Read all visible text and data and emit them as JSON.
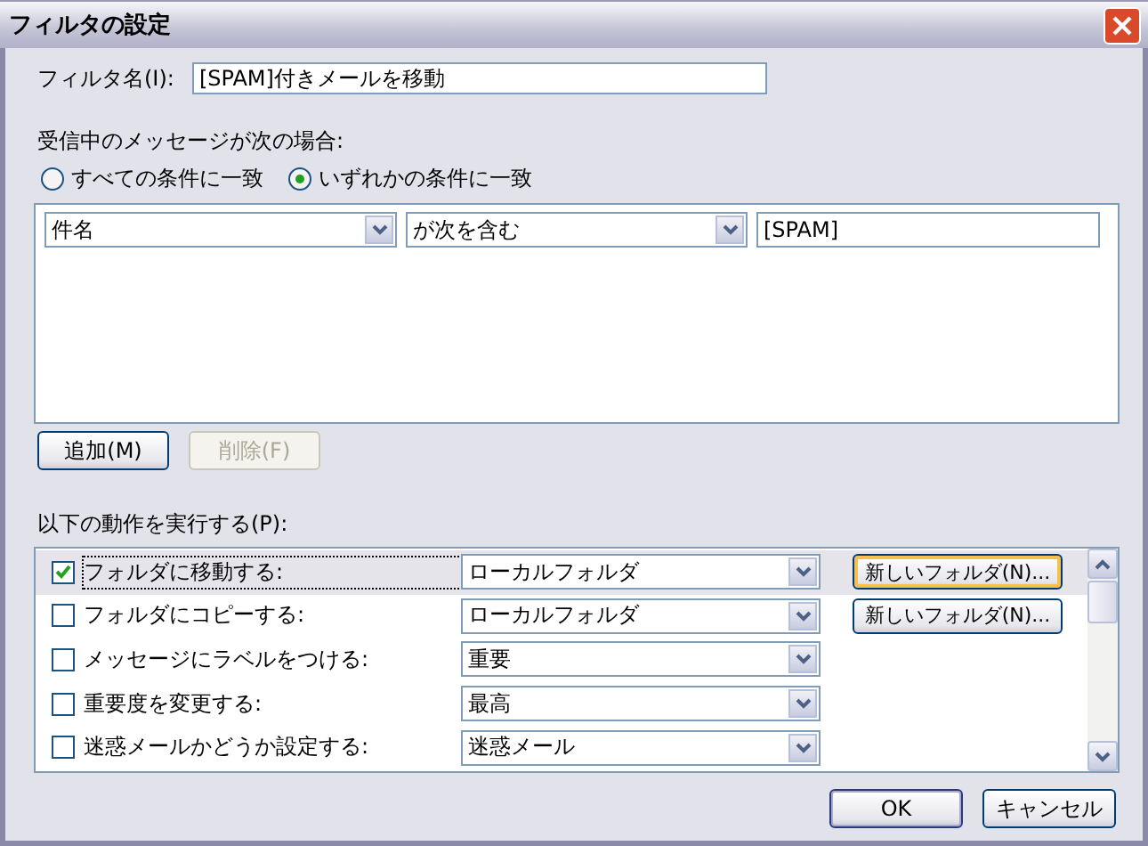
{
  "window": {
    "title": "フィルタの設定"
  },
  "filter_name": {
    "label": "フィルタ名(I):",
    "value": "[SPAM]付きメールを移動"
  },
  "match": {
    "label": "受信中のメッセージが次の場合:",
    "options": [
      {
        "label": "すべての条件に一致",
        "selected": false
      },
      {
        "label": "いずれかの条件に一致",
        "selected": true
      }
    ]
  },
  "conditions": [
    {
      "field": "件名",
      "operator": "が次を含む",
      "value": "[SPAM]"
    }
  ],
  "condition_buttons": [
    {
      "label": "追加(M)",
      "disabled": false
    },
    {
      "label": "削除(F)",
      "disabled": true
    }
  ],
  "actions_label": "以下の動作を実行する(P):",
  "actions": [
    {
      "label": "フォルダに移動する:",
      "checked": true,
      "selected": true,
      "value": "ローカルフォルダ",
      "button": "新しいフォルダ(N)..."
    },
    {
      "label": "フォルダにコピーする:",
      "checked": false,
      "selected": false,
      "value": "ローカルフォルダ",
      "button": "新しいフォルダ(N)..."
    },
    {
      "label": "メッセージにラベルをつける:",
      "checked": false,
      "selected": false,
      "value": "重要"
    },
    {
      "label": "重要度を変更する:",
      "checked": false,
      "selected": false,
      "value": "最高"
    },
    {
      "label": "迷惑メールかどうか設定する:",
      "checked": false,
      "selected": false,
      "value": "迷惑メール"
    }
  ],
  "buttons": [
    {
      "label": "OK",
      "default": true
    },
    {
      "label": "キャンセル",
      "default": false
    }
  ]
}
